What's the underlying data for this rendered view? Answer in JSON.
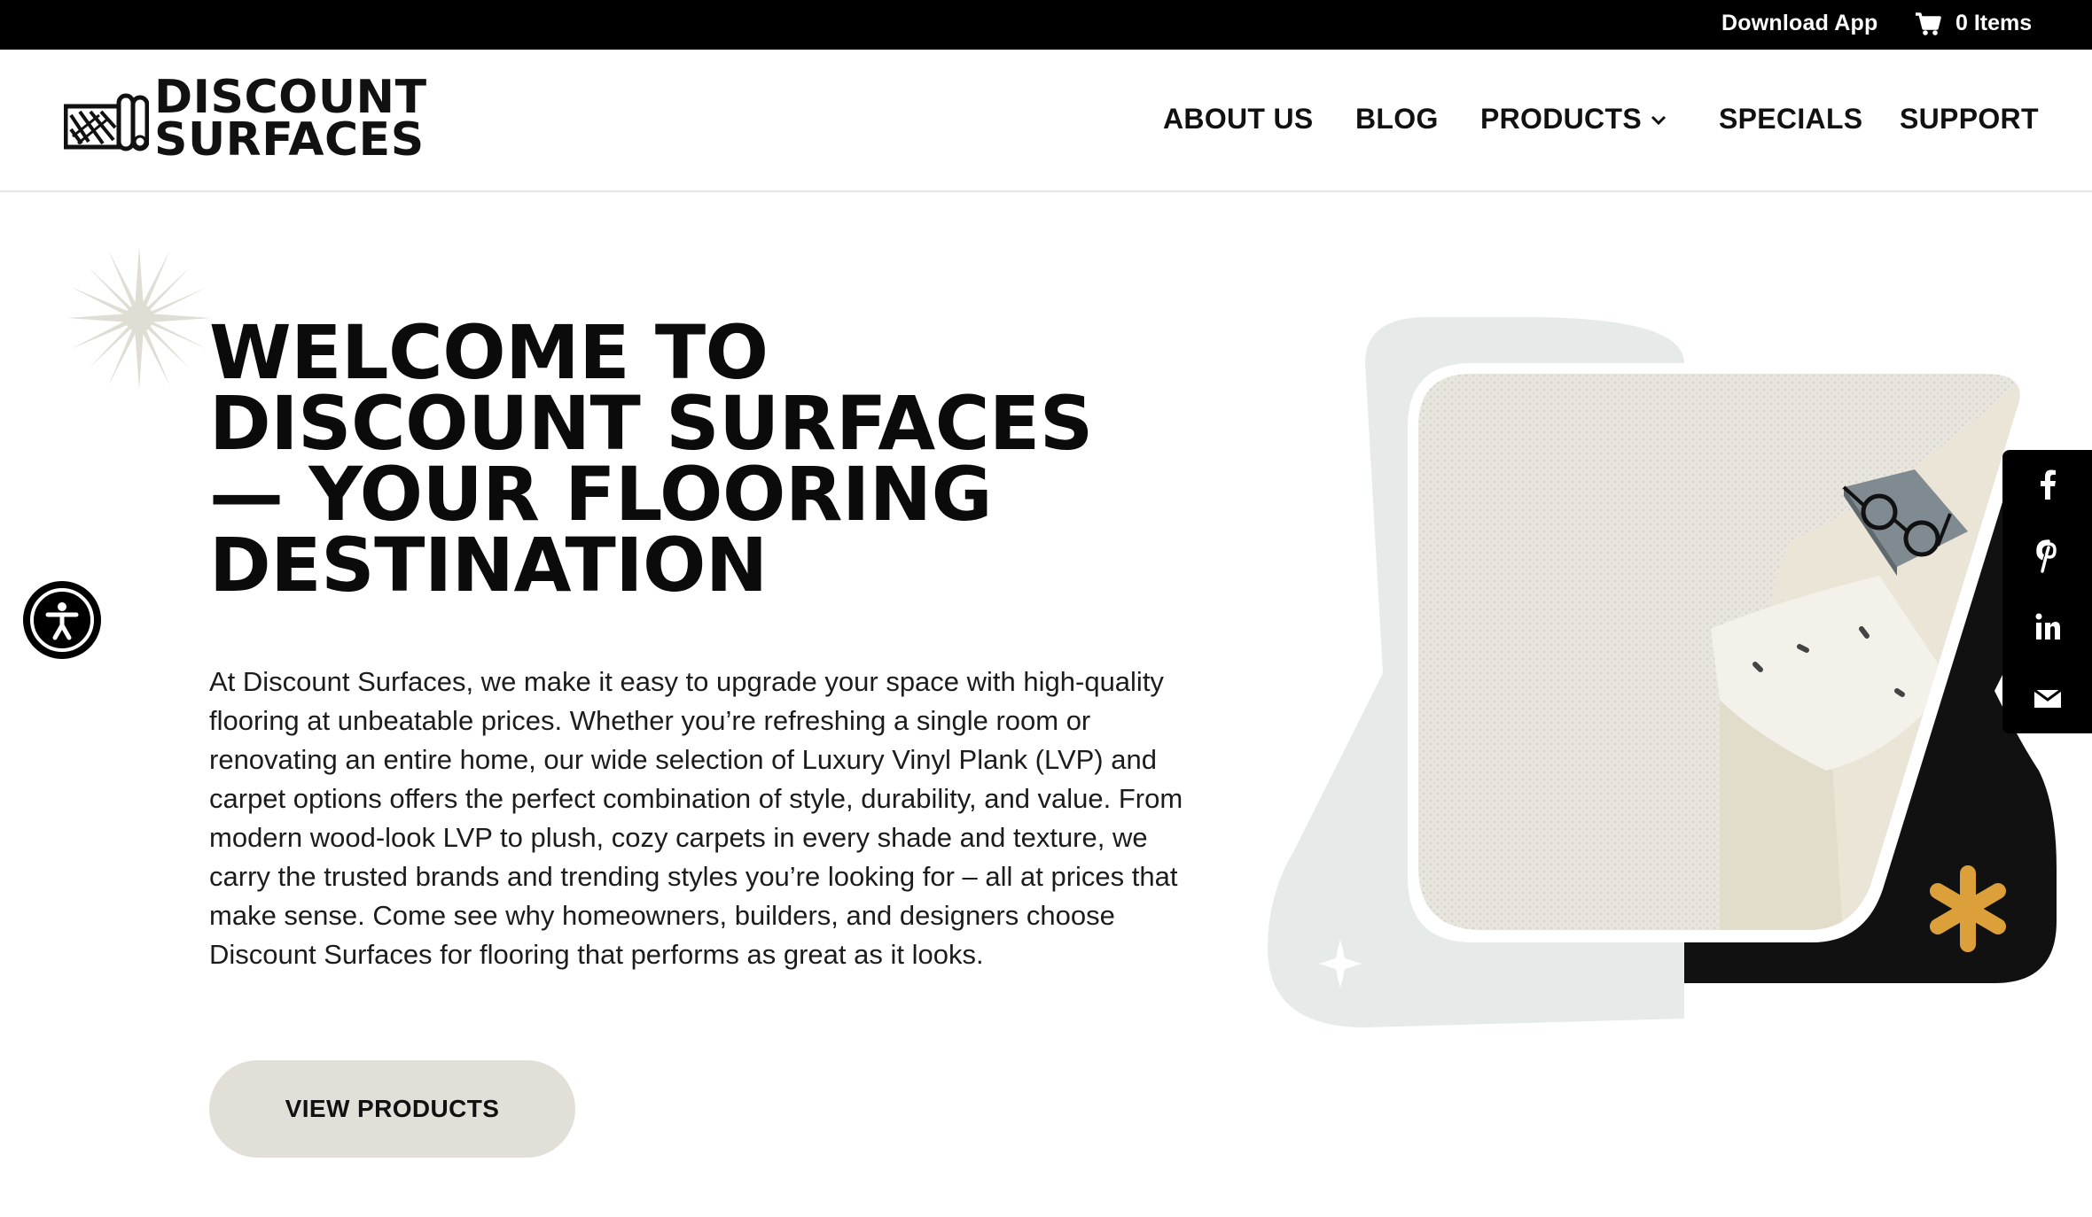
{
  "topbar": {
    "download_label": "Download App",
    "cart_icon": "cart-icon",
    "cart_count_label": "0 Items"
  },
  "header": {
    "logo": {
      "line1": "DISCOUNT",
      "line2": "SURFACES"
    },
    "nav": [
      {
        "label": "ABOUT US"
      },
      {
        "label": "BLOG"
      },
      {
        "label": "PRODUCTS",
        "has_dropdown": true
      },
      {
        "label": "SPECIALS"
      },
      {
        "label": "SUPPORT"
      }
    ]
  },
  "hero": {
    "title_lines": [
      "WELCOME TO",
      "DISCOUNT SURFACES",
      "— YOUR FLOORING",
      "DESTINATION"
    ],
    "body": "At Discount Surfaces, we make it easy to upgrade your space with high-quality flooring at unbeatable prices. Whether you’re refreshing a single room or renovating an entire home, our wide selection of Luxury Vinyl Plank (LVP) and carpet options offers the perfect combination of style, durability, and value. From modern wood-look LVP to plush, cozy carpets in every shade and texture, we carry the trusted brands and trending styles you’re looking for – all at prices that make sense. Come see why homeowners, builders, and designers choose Discount Surfaces for flooring that performs as great as it looks.",
    "cta_label": "VIEW PRODUCTS"
  },
  "social": [
    {
      "icon": "facebook-icon",
      "glyph": "f"
    },
    {
      "icon": "pinterest-icon",
      "glyph": "p"
    },
    {
      "icon": "linkedin-icon",
      "glyph": "in"
    },
    {
      "icon": "email-icon",
      "glyph": "✉"
    }
  ],
  "colors": {
    "topbar": "#000000",
    "button_bg": "#e2dfd9",
    "accent_orange": "#dba03a",
    "pale_shape": "#e6ebea",
    "sparkle": "#e0ddd4"
  }
}
